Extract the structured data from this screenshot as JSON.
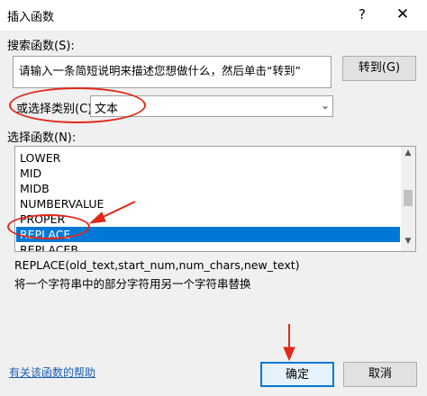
{
  "dialog": {
    "title": "插入函数",
    "help_glyph": "?",
    "close_glyph": "✕"
  },
  "search": {
    "label": "搜索函数(S):",
    "value": "请输入一条简短说明来描述您想做什么，然后单击“转到”",
    "goto_label": "转到(G)"
  },
  "category": {
    "label": "或选择类别(C):",
    "selected": "文本"
  },
  "functions": {
    "label": "选择函数(N):",
    "items": [
      "LOWER",
      "MID",
      "MIDB",
      "NUMBERVALUE",
      "PROPER",
      "REPLACE",
      "REPLACEB"
    ],
    "selected_index": 5
  },
  "details": {
    "syntax": "REPLACE(old_text,start_num,num_chars,new_text)",
    "description": "将一个字符串中的部分字符用另一个字符串替换"
  },
  "footer": {
    "help_link": "有关该函数的帮助",
    "ok_label": "确定",
    "cancel_label": "取消"
  },
  "annotation_color": "#e2281a",
  "selection_color": "#0078d7"
}
